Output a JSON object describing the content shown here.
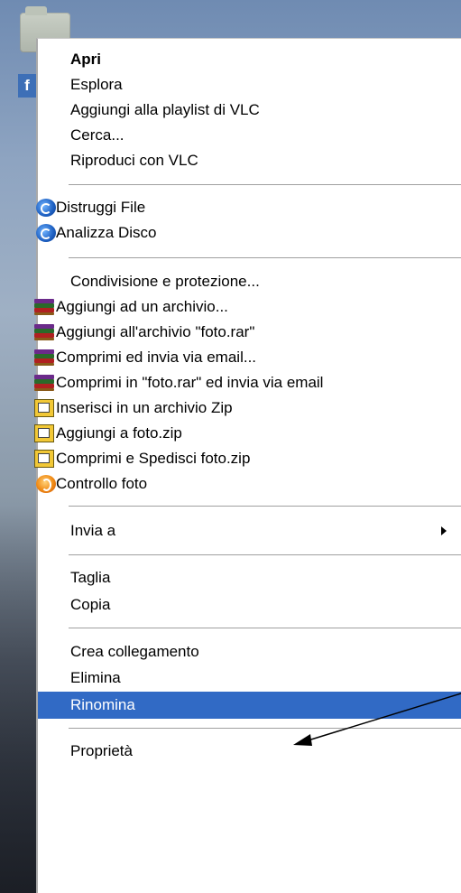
{
  "menu": {
    "items": [
      {
        "label": "Apri"
      },
      {
        "label": "Esplora"
      },
      {
        "label": "Aggiungi alla playlist di VLC"
      },
      {
        "label": "Cerca..."
      },
      {
        "label": "Riproduci con VLC"
      },
      {
        "label": "Distruggi File"
      },
      {
        "label": "Analizza Disco"
      },
      {
        "label": "Condivisione e protezione..."
      },
      {
        "label": "Aggiungi ad un archivio..."
      },
      {
        "label": "Aggiungi all'archivio \"foto.rar\""
      },
      {
        "label": "Comprimi ed invia via email..."
      },
      {
        "label": "Comprimi in \"foto.rar\" ed invia via email"
      },
      {
        "label": "Inserisci in un archivio Zip"
      },
      {
        "label": "Aggiungi a foto.zip"
      },
      {
        "label": "Comprimi e Spedisci foto.zip"
      },
      {
        "label": "Controllo foto"
      },
      {
        "label": "Invia a"
      },
      {
        "label": "Taglia"
      },
      {
        "label": "Copia"
      },
      {
        "label": "Crea collegamento"
      },
      {
        "label": "Elimina"
      },
      {
        "label": "Rinomina"
      },
      {
        "label": "Proprietà"
      }
    ]
  },
  "icons": {
    "vlc": "disk-utility-icon",
    "rar": "winrar-archive-icon",
    "zip": "zip-archive-icon",
    "foto": "check-photo-icon",
    "shortcut": "f"
  },
  "colors": {
    "highlight": "#316ac5",
    "menu_bg": "#ffffff"
  }
}
